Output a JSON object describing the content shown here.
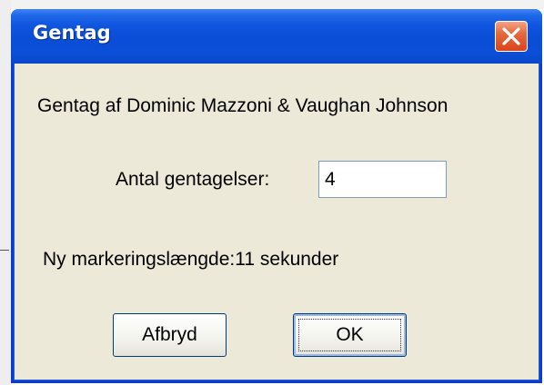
{
  "window": {
    "title": "Gentag",
    "close_label": "close"
  },
  "dialog": {
    "credit": "Gentag af Dominic Mazzoni & Vaughan Johnson",
    "repeat_label": "Antal gentagelser:",
    "repeat_value": "4",
    "selection_length": "Ny markeringslængde:11 sekunder"
  },
  "buttons": {
    "cancel_label": "Afbryd",
    "ok_label": "OK"
  },
  "colors": {
    "titlebar": "#0A4DD6",
    "dialog_bg": "#ECE9D8",
    "close_button": "#D9431C",
    "button_border": "#003C74"
  },
  "icons": {
    "close": "close-x-icon"
  }
}
